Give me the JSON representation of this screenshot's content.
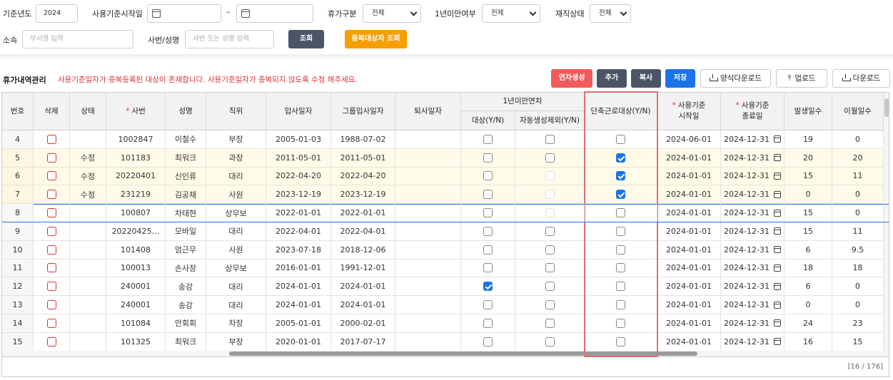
{
  "filters": {
    "year_label": "기준년도",
    "year_value": "2024",
    "start_label": "사용기준시작일",
    "tilde": "–",
    "leave_type_label": "휴가구분",
    "leave_type_value": "전체",
    "under_year_label": "1년미만여부",
    "under_year_value": "전체",
    "employment_label": "재직상태",
    "employment_value": "전체",
    "dept_label": "소속",
    "dept_placeholder": "부서명 입력",
    "emp_label": "사번/성명",
    "emp_placeholder": "사번 또는 성명 입력",
    "search_btn": "조회",
    "dup_btn": "중복대상자 조회"
  },
  "section": {
    "title": "휴가내역관리",
    "warning": "사용기준일자가 중복등록된 대상이 존재합니다. 사용기준일자가 중복되지 않도록 수정 해주세요."
  },
  "toolbar": {
    "generate": "연차생성",
    "add": "추가",
    "copy": "복사",
    "save": "저장",
    "template_download": "양식다운로드",
    "upload": "업로드",
    "download": "다운로드"
  },
  "colors": {
    "accent_red": "#e03131",
    "orange": "#f59f00",
    "blue": "#1a73e8",
    "dark": "#4a5568",
    "generate": "#f05a5a"
  },
  "columns": {
    "no": "번호",
    "del": "삭제",
    "state": "상태",
    "req": "*",
    "emp_no": "사번",
    "name": "성명",
    "title": "직위",
    "join": "입사일자",
    "group_join": "그룹입사일자",
    "leave": "퇴사일자",
    "under_year_group": "1년미만연차",
    "target": "대상(Y/N)",
    "auto_exclude": "자동생성제외(Y/N)",
    "short_work": "단축근로대상(Y/N)",
    "start_1": "사용기준",
    "start_2": "시작일",
    "end_1": "사용기준",
    "end_2": "종료일",
    "occur": "발생일수",
    "carry": "이월일수"
  },
  "rows": [
    {
      "no": "4",
      "state": "",
      "emp_no": "1002847",
      "name": "이철수",
      "title": "부장",
      "join": "2005-01-03",
      "group_join": "1988-07-02",
      "target": false,
      "auto_dis": false,
      "short": false,
      "start": "2024-06-01",
      "end": "2024-12-31",
      "occur": "19",
      "carry": "0",
      "yellow": false
    },
    {
      "no": "5",
      "state": "수정",
      "emp_no": "101183",
      "name": "최워크",
      "title": "과장",
      "join": "2011-05-01",
      "group_join": "2011-05-01",
      "target": false,
      "auto_dis": false,
      "short": true,
      "start": "2024-01-01",
      "end": "2024-12-31",
      "occur": "20",
      "carry": "20",
      "yellow": true
    },
    {
      "no": "6",
      "state": "수정",
      "emp_no": "20220401",
      "name": "신인류",
      "title": "대리",
      "join": "2022-04-20",
      "group_join": "2022-04-20",
      "target": false,
      "auto_dis": true,
      "short": true,
      "start": "2024-01-01",
      "end": "2024-12-31",
      "occur": "15",
      "carry": "11",
      "yellow": true
    },
    {
      "no": "7",
      "state": "수정",
      "emp_no": "231219",
      "name": "김공채",
      "title": "사원",
      "join": "2023-12-19",
      "group_join": "2023-12-19",
      "target": false,
      "auto_dis": true,
      "short": true,
      "start": "2024-01-01",
      "end": "2024-12-31",
      "occur": "0",
      "carry": "0",
      "yellow": true
    },
    {
      "no": "8",
      "state": "",
      "emp_no": "100807",
      "name": "차태현",
      "title": "상무보",
      "join": "2022-01-01",
      "group_join": "2022-01-01",
      "target": false,
      "auto_dis": true,
      "short": false,
      "start": "2024-01-01",
      "end": "2024-12-31",
      "occur": "15",
      "carry": "0",
      "yellow": false,
      "selected": true
    },
    {
      "no": "9",
      "state": "",
      "emp_no": "20220425…",
      "name": "모바일",
      "title": "대리",
      "join": "2022-04-01",
      "group_join": "2022-04-01",
      "target": false,
      "auto_dis": false,
      "short": false,
      "start": "2024-01-01",
      "end": "2024-12-31",
      "occur": "15",
      "carry": "11",
      "yellow": false
    },
    {
      "no": "10",
      "state": "",
      "emp_no": "101408",
      "name": "엄근무",
      "title": "사원",
      "join": "2023-07-18",
      "group_join": "2018-12-06",
      "target": false,
      "auto_dis": false,
      "short": false,
      "start": "2024-01-01",
      "end": "2024-12-31",
      "occur": "6",
      "carry": "9.5",
      "yellow": false
    },
    {
      "no": "11",
      "state": "",
      "emp_no": "100013",
      "name": "손사장",
      "title": "상무보",
      "join": "2016-01-01",
      "group_join": "1991-12-01",
      "target": false,
      "auto_dis": false,
      "short": false,
      "start": "2024-01-01",
      "end": "2024-12-31",
      "occur": "18",
      "carry": "18",
      "yellow": false
    },
    {
      "no": "12",
      "state": "",
      "emp_no": "240001",
      "name": "송강",
      "title": "대리",
      "join": "2024-01-01",
      "group_join": "2024-01-01",
      "target": true,
      "auto_dis": false,
      "short": false,
      "start": "2024-01-01",
      "end": "2024-12-31",
      "occur": "6",
      "carry": "0",
      "yellow": false
    },
    {
      "no": "13",
      "state": "",
      "emp_no": "240001",
      "name": "송강",
      "title": "대리",
      "join": "2024-01-01",
      "group_join": "2024-01-01",
      "target": false,
      "auto_dis": false,
      "short": false,
      "start": "2024-01-01",
      "end": "2024-12-31",
      "occur": "0",
      "carry": "0",
      "yellow": false
    },
    {
      "no": "14",
      "state": "",
      "emp_no": "101084",
      "name": "안회회",
      "title": "차장",
      "join": "2005-01-01",
      "group_join": "2000-02-01",
      "target": false,
      "auto_dis": false,
      "short": false,
      "start": "2024-01-01",
      "end": "2024-12-31",
      "occur": "24",
      "carry": "23",
      "yellow": false
    },
    {
      "no": "15",
      "state": "",
      "emp_no": "101325",
      "name": "최워크",
      "title": "부장",
      "join": "2020-01-01",
      "group_join": "2017-07-17",
      "target": false,
      "auto_dis": false,
      "short": false,
      "start": "2024-01-01",
      "end": "2024-12-31",
      "occur": "16",
      "carry": "15",
      "yellow": false
    }
  ],
  "pager": "[16 / 176]"
}
